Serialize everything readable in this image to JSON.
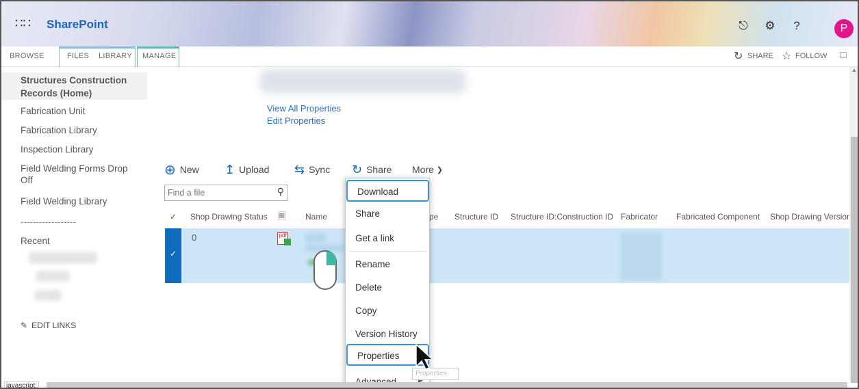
{
  "app": {
    "brand": "SharePoint",
    "avatar_initial": "P"
  },
  "ribbon": {
    "tabs": [
      "BROWSE",
      "FILES",
      "LIBRARY",
      "MANAGE"
    ],
    "actions": {
      "share": "SHARE",
      "follow": "FOLLOW"
    }
  },
  "leftnav": {
    "home": "Structures Construction Records (Home)",
    "items": [
      "Fabrication Unit",
      "Fabrication Library",
      "Inspection Library",
      "Field Welding Forms Drop Off",
      "Field Welding Library"
    ],
    "separator": "------------------",
    "recent": "Recent",
    "edit_links": "EDIT LINKS"
  },
  "properties": {
    "view_all": "View All Properties",
    "edit": "Edit Properties"
  },
  "commands": {
    "new": "New",
    "upload": "Upload",
    "sync": "Sync",
    "share": "Share",
    "more": "More"
  },
  "search": {
    "placeholder": "Find a file"
  },
  "columns": [
    "Shop Drawing Status",
    "Name",
    "pe",
    "Structure ID",
    "Structure ID:Construction ID",
    "Fabricator",
    "Fabricated Component",
    "Shop Drawing Version"
  ],
  "row": {
    "status": "0"
  },
  "context_menu": {
    "items": [
      "Download",
      "Share",
      "Get a link",
      "Rename",
      "Delete",
      "Copy",
      "Version History",
      "Properties",
      "Advanced"
    ]
  },
  "tooltip": "Properties",
  "statusbar": "javascript:"
}
